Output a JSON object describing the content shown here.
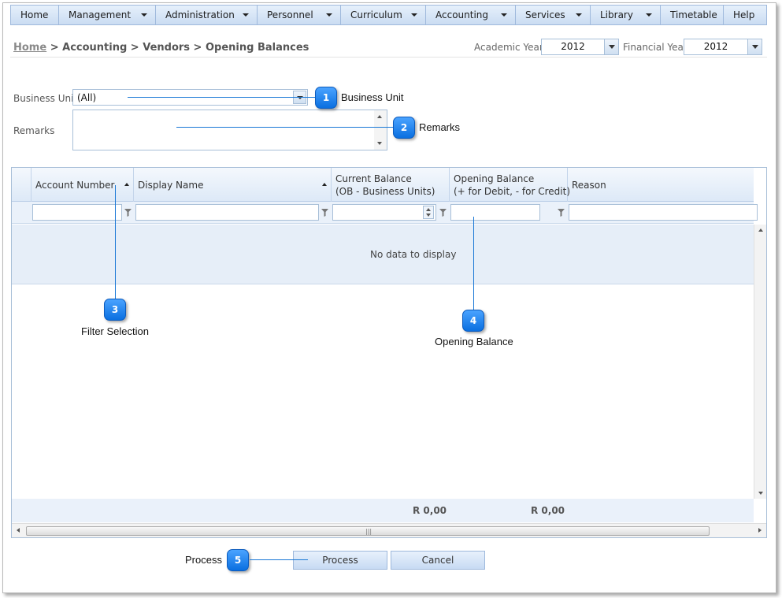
{
  "menu": [
    {
      "label": "Home",
      "dropdown": false
    },
    {
      "label": "Management",
      "dropdown": true
    },
    {
      "label": "Administration",
      "dropdown": true
    },
    {
      "label": "Personnel",
      "dropdown": true
    },
    {
      "label": "Curriculum",
      "dropdown": true
    },
    {
      "label": "Accounting",
      "dropdown": true
    },
    {
      "label": "Services",
      "dropdown": true
    },
    {
      "label": "Library",
      "dropdown": true
    },
    {
      "label": "Timetable",
      "dropdown": false
    },
    {
      "label": "Help",
      "dropdown": false
    }
  ],
  "breadcrumb": {
    "home": "Home",
    "rest": " > Accounting > Vendors > Opening Balances"
  },
  "years": {
    "academic_label": "Academic Year",
    "academic_value": "2012",
    "financial_label": "Financial Year",
    "financial_value": "2012"
  },
  "form": {
    "business_unit_label": "Business Unit",
    "business_unit_value": "(All)",
    "remarks_label": "Remarks",
    "remarks_value": ""
  },
  "grid": {
    "columns": [
      {
        "line1": "Account Number",
        "line2": "",
        "sort": "asc"
      },
      {
        "line1": "Display Name",
        "line2": "",
        "sort": "asc"
      },
      {
        "line1": "Current Balance",
        "line2": "(OB - Business Units)",
        "sort": ""
      },
      {
        "line1": "Opening Balance",
        "line2": "(+ for Debit, - for Credit)",
        "sort": ""
      },
      {
        "line1": "Reason",
        "line2": "",
        "sort": ""
      }
    ],
    "no_data": "No data to display",
    "totals": {
      "current_balance": "R 0,00",
      "opening_balance": "R 0,00"
    }
  },
  "buttons": {
    "process": "Process",
    "cancel": "Cancel"
  },
  "callouts": [
    {
      "num": "1",
      "label": "Business Unit"
    },
    {
      "num": "2",
      "label": "Remarks"
    },
    {
      "num": "3",
      "label": "Filter Selection"
    },
    {
      "num": "4",
      "label": "Opening Balance"
    },
    {
      "num": "5",
      "label": "Process"
    }
  ],
  "colors": {
    "callout": "#0a6fe0",
    "menu_bg": "#cadcf2",
    "row_bg": "#e6eef8"
  }
}
